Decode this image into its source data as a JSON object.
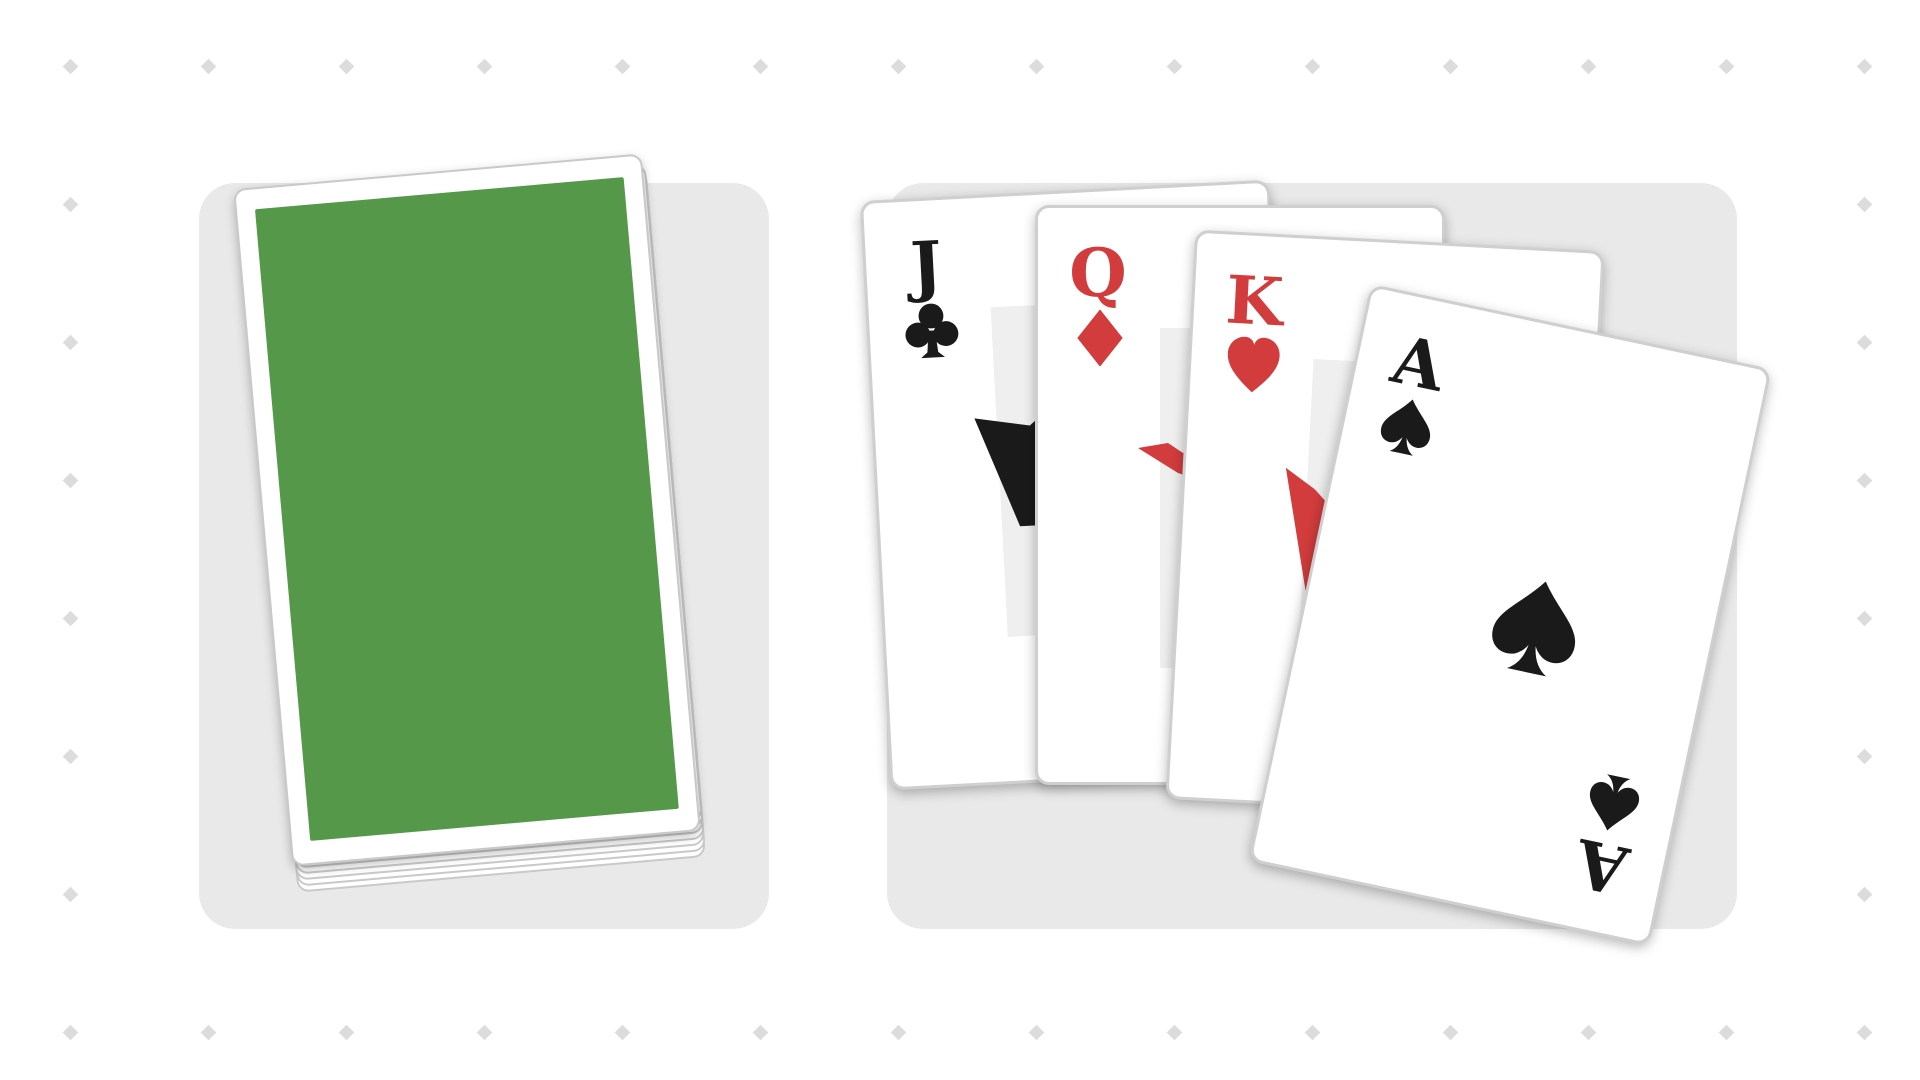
{
  "board": {
    "colors": {
      "background": "#ffffff",
      "zone": "#e9e9e9",
      "dot": "#dcdcdc",
      "card_back": "#55984a",
      "red_suit": "#d23c3c",
      "black_suit": "#1a1a1a"
    }
  },
  "deck": {
    "face_down": true,
    "back_color": "#55984a"
  },
  "hand": {
    "cards": [
      {
        "rank": "J",
        "suit": "clubs",
        "suit_icon": "club-icon",
        "color": "#1a1a1a"
      },
      {
        "rank": "Q",
        "suit": "diamonds",
        "suit_icon": "diamond-icon",
        "color": "#d23c3c"
      },
      {
        "rank": "K",
        "suit": "hearts",
        "suit_icon": "heart-icon",
        "color": "#d23c3c"
      },
      {
        "rank": "A",
        "suit": "spades",
        "suit_icon": "spade-icon",
        "color": "#1a1a1a"
      }
    ]
  }
}
